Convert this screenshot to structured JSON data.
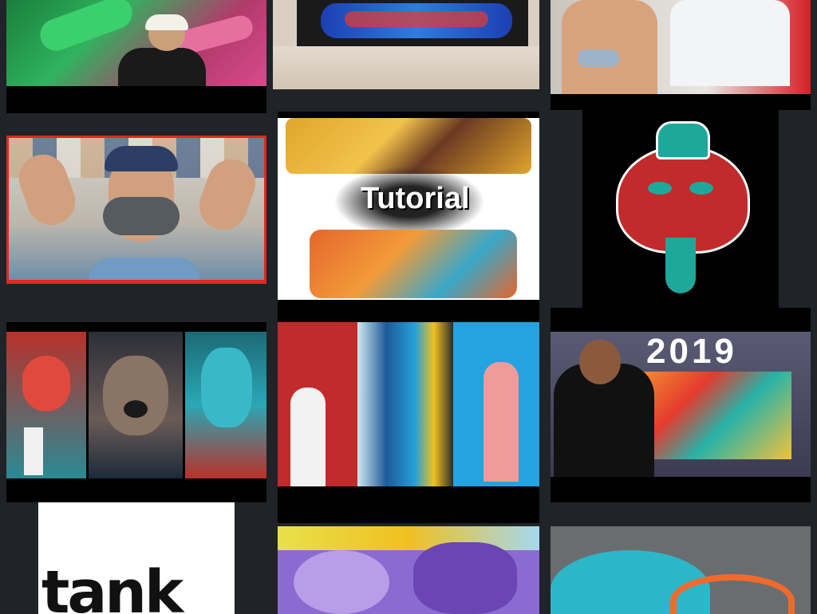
{
  "gallery": {
    "title": "",
    "tiles": [
      {
        "id": "t1",
        "caption": ""
      },
      {
        "id": "t2",
        "caption": ""
      },
      {
        "id": "t3",
        "caption": ""
      },
      {
        "id": "t4",
        "caption": ""
      },
      {
        "id": "t5",
        "caption": "Tutorial"
      },
      {
        "id": "t6",
        "caption": ""
      },
      {
        "id": "t7",
        "caption": ""
      },
      {
        "id": "t8",
        "caption": ""
      },
      {
        "id": "t9",
        "caption": "2019"
      },
      {
        "id": "t10",
        "caption": "tank"
      },
      {
        "id": "t11",
        "caption": ""
      },
      {
        "id": "t12",
        "caption": ""
      }
    ]
  },
  "colors": {
    "background": "#202327",
    "tile_frame": "#000000",
    "highlight_border": "#e52521",
    "mural_green": "#2fb35e",
    "sky_blue": "#23a3df",
    "tag_red": "#c22b2b"
  }
}
